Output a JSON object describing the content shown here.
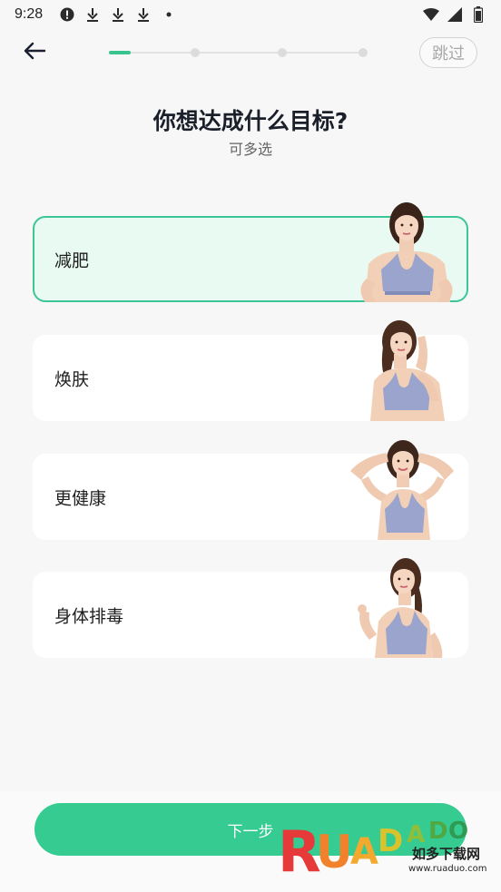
{
  "status_bar": {
    "time": "9:28",
    "icons": [
      "alert-circle-icon",
      "download-icon",
      "download-icon",
      "download-icon",
      "dot-icon"
    ],
    "right_icons": [
      "wifi-icon",
      "signal-icon",
      "battery-icon"
    ]
  },
  "nav": {
    "back_icon": "arrow-left-icon",
    "skip_label": "跳过",
    "progress": {
      "current_step": 1,
      "total_steps": 4
    }
  },
  "heading": {
    "title": "你想达成什么目标?",
    "subtitle": "可多选"
  },
  "options": [
    {
      "label": "减肥",
      "selected": true
    },
    {
      "label": "焕肤",
      "selected": false
    },
    {
      "label": "更健康",
      "selected": false
    },
    {
      "label": "身体排毒",
      "selected": false
    }
  ],
  "footer": {
    "next_label": "下一步"
  },
  "watermark": {
    "brand": "RUANDADO",
    "subtitle": "如多下载网",
    "url": "www.ruaduo.com"
  },
  "colors": {
    "accent": "#36cb91",
    "selected_bg": "#e9faf3",
    "selected_border": "#3cc596",
    "title": "#1a1f2a"
  }
}
